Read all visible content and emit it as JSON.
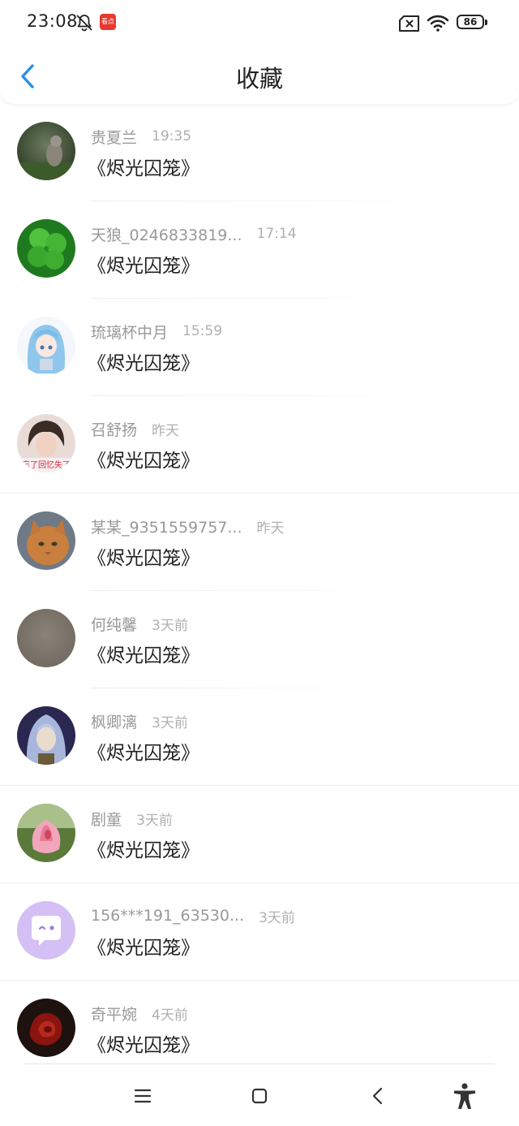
{
  "status_bar": {
    "time": "23:08",
    "app_badge": "看点",
    "battery_level": "86"
  },
  "header": {
    "title": "收藏"
  },
  "items": [
    {
      "name": "贵夏兰",
      "time": "19:35",
      "title": "《烬光囚笼》",
      "avatar": "rabbit-photo"
    },
    {
      "name": "天狼_0246833819...",
      "time": "17:14",
      "title": "《烬光囚笼》",
      "avatar": "clover-photo"
    },
    {
      "name": "琉璃杯中月",
      "time": "15:59",
      "title": "《烬光囚笼》",
      "avatar": "anime-girl-drawing"
    },
    {
      "name": "召舒扬",
      "time": "昨天",
      "title": "《烬光囚笼》",
      "avatar": "selfie-photo"
    },
    {
      "name": "某某_9351559757...",
      "time": "昨天",
      "title": "《烬光囚笼》",
      "avatar": "cat-photo"
    },
    {
      "name": "何纯馨",
      "time": "3天前",
      "title": "《烬光囚笼》",
      "avatar": "blurred-photo"
    },
    {
      "name": "枫卿漓",
      "time": "3天前",
      "title": "《烬光囚笼》",
      "avatar": "anime-character"
    },
    {
      "name": "剧童",
      "time": "3天前",
      "title": "《烬光囚笼》",
      "avatar": "pink-flower-photo"
    },
    {
      "name": "156***191_63530...",
      "time": "3天前",
      "title": "《烬光囚笼》",
      "avatar": "default-chat-avatar"
    },
    {
      "name": "奇平婉",
      "time": "4天前",
      "title": "《烬光囚笼》",
      "avatar": "red-rose-photo"
    }
  ],
  "avatar_text": {
    "selfie_caption": "忘了回忆失了"
  },
  "colors": {
    "accent": "#2b8fe8",
    "name_gray": "#999999",
    "time_gray": "#b0b0b0",
    "default_avatar_bg": "#d4c0f4"
  }
}
